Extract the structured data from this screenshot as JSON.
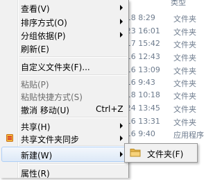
{
  "background": {
    "type_header": "类型",
    "rows": [
      {
        "date": "/18 8:29",
        "type": "文件夹"
      },
      {
        "date": "/23 16:01",
        "type": "文件夹"
      },
      {
        "date": "/17 15:42",
        "type": "文件夹"
      },
      {
        "date": "/16 12:43",
        "type": "文件夹"
      },
      {
        "date": "/16 13:09",
        "type": "文件夹"
      },
      {
        "date": "/16 9:43",
        "type": "文件夹"
      },
      {
        "date": "/18 10:18",
        "type": "文件夹"
      },
      {
        "date": "/24 13:45",
        "type": "文件夹"
      },
      {
        "date": "/16 13:31",
        "type": "文件夹"
      },
      {
        "date": "/16 9:40",
        "type": "应用程序"
      }
    ]
  },
  "menu": {
    "view": "查看(V)",
    "sort_by": "排序方式(O)",
    "group_by": "分组依据(P)",
    "refresh": "刷新(E)",
    "customize_folder": "自定义文件夹(F)...",
    "paste": "粘贴(P)",
    "paste_shortcut": "粘贴快捷方式(S)",
    "undo_move": "撤消 移动(U)",
    "undo_shortcut": "Ctrl+Z",
    "share": "共享(H)",
    "shared_folder_sync": "共享文件夹同步",
    "new": "新建(W)",
    "properties": "属性(R)"
  },
  "submenu": {
    "folder": "文件夹(F)"
  },
  "icons": {
    "share_sync": "share-sync-icon",
    "folder": "folder-icon"
  }
}
